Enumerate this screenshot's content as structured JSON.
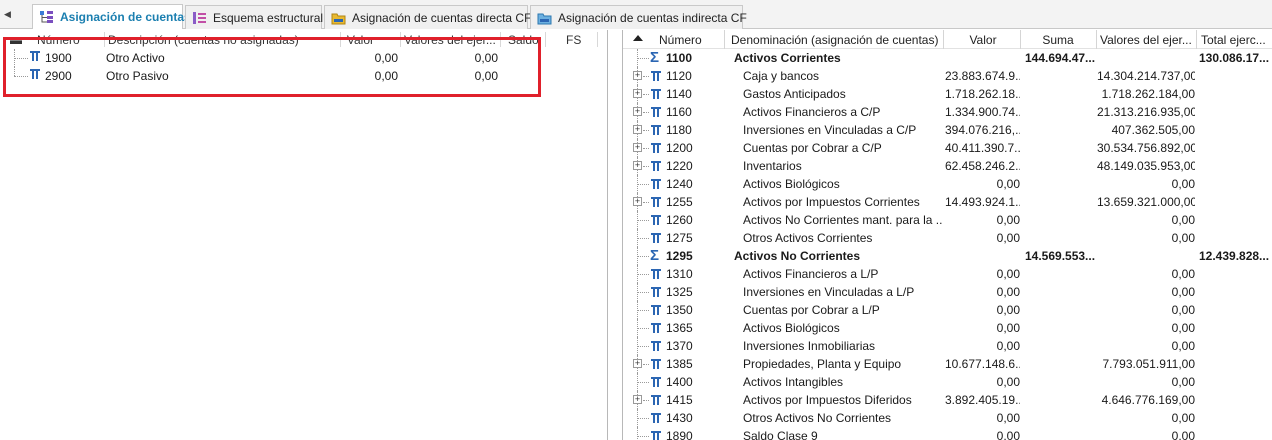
{
  "tabs": [
    {
      "label": "Asignación de cuentas",
      "icon": "hierarchy-icon",
      "active": true
    },
    {
      "label": "Esquema estructural",
      "icon": "structure-icon",
      "active": false
    },
    {
      "label": "Asignación de cuentas directa CF",
      "icon": "folder-icon",
      "active": false
    },
    {
      "label": "Asignación de cuentas indirecta CF",
      "icon": "folder-icon",
      "active": false
    }
  ],
  "left": {
    "headers": {
      "numero": "Número",
      "descripcion": "Descripción (cuentas no asignadas)",
      "valor": "Valor",
      "valores_ejer": "Valores del ejer...",
      "saldo": "Saldo",
      "fs": "FS"
    },
    "rows": [
      {
        "numero": "1900",
        "descripcion": "Otro Activo",
        "valor": "0,00",
        "valores_ejer": "0,00"
      },
      {
        "numero": "2900",
        "descripcion": "Otro Pasivo",
        "valor": "0,00",
        "valores_ejer": "0,00"
      }
    ]
  },
  "right": {
    "headers": {
      "numero": "Número",
      "denominacion": "Denominación (asignación de cuentas)",
      "valor": "Valor",
      "suma": "Suma",
      "valores_ejer": "Valores del ejer...",
      "total_ejerc": "Total ejerc..."
    },
    "rows": [
      {
        "numero": "1100",
        "denominacion": "Activos Corrientes",
        "valor": "",
        "suma": "144.694.47...",
        "valores_ejer": "",
        "total_ejerc": "130.086.17...",
        "type": "sum",
        "expander": false
      },
      {
        "numero": "1120",
        "denominacion": "Caja y bancos",
        "valor": "23.883.674.9...",
        "suma": "",
        "valores_ejer": "14.304.214.737,00",
        "total_ejerc": "",
        "type": "acc",
        "expander": true
      },
      {
        "numero": "1140",
        "denominacion": "Gastos Anticipados",
        "valor": "1.718.262.18...",
        "suma": "",
        "valores_ejer": "1.718.262.184,00",
        "total_ejerc": "",
        "type": "acc",
        "expander": true
      },
      {
        "numero": "1160",
        "denominacion": "Activos Financieros a C/P",
        "valor": "1.334.900.74...",
        "suma": "",
        "valores_ejer": "21.313.216.935,00",
        "total_ejerc": "",
        "type": "acc",
        "expander": true
      },
      {
        "numero": "1180",
        "denominacion": "Inversiones en Vinculadas a C/P",
        "valor": "394.076.216,...",
        "suma": "",
        "valores_ejer": "407.362.505,00",
        "total_ejerc": "",
        "type": "acc",
        "expander": true
      },
      {
        "numero": "1200",
        "denominacion": "Cuentas por Cobrar a C/P",
        "valor": "40.411.390.7...",
        "suma": "",
        "valores_ejer": "30.534.756.892,00",
        "total_ejerc": "",
        "type": "acc",
        "expander": true
      },
      {
        "numero": "1220",
        "denominacion": "Inventarios",
        "valor": "62.458.246.2...",
        "suma": "",
        "valores_ejer": "48.149.035.953,00",
        "total_ejerc": "",
        "type": "acc",
        "expander": true
      },
      {
        "numero": "1240",
        "denominacion": "Activos Biológicos",
        "valor": "0,00",
        "suma": "",
        "valores_ejer": "0,00",
        "total_ejerc": "",
        "type": "acc",
        "expander": false
      },
      {
        "numero": "1255",
        "denominacion": "Activos por Impuestos Corrientes",
        "valor": "14.493.924.1...",
        "suma": "",
        "valores_ejer": "13.659.321.000,00",
        "total_ejerc": "",
        "type": "acc",
        "expander": true
      },
      {
        "numero": "1260",
        "denominacion": "Activos No Corrientes mant. para la ...",
        "valor": "0,00",
        "suma": "",
        "valores_ejer": "0,00",
        "total_ejerc": "",
        "type": "acc",
        "expander": false
      },
      {
        "numero": "1275",
        "denominacion": "Otros Activos Corrientes",
        "valor": "0,00",
        "suma": "",
        "valores_ejer": "0,00",
        "total_ejerc": "",
        "type": "acc",
        "expander": false
      },
      {
        "numero": "1295",
        "denominacion": "Activos No Corrientes",
        "valor": "",
        "suma": "14.569.553...",
        "valores_ejer": "",
        "total_ejerc": "12.439.828...",
        "type": "sum",
        "expander": false
      },
      {
        "numero": "1310",
        "denominacion": "Activos Financieros a L/P",
        "valor": "0,00",
        "suma": "",
        "valores_ejer": "0,00",
        "total_ejerc": "",
        "type": "acc",
        "expander": false
      },
      {
        "numero": "1325",
        "denominacion": "Inversiones en Vinculadas a L/P",
        "valor": "0,00",
        "suma": "",
        "valores_ejer": "0,00",
        "total_ejerc": "",
        "type": "acc",
        "expander": false
      },
      {
        "numero": "1350",
        "denominacion": "Cuentas por Cobrar a L/P",
        "valor": "0,00",
        "suma": "",
        "valores_ejer": "0,00",
        "total_ejerc": "",
        "type": "acc",
        "expander": false
      },
      {
        "numero": "1365",
        "denominacion": "Activos Biológicos",
        "valor": "0,00",
        "suma": "",
        "valores_ejer": "0,00",
        "total_ejerc": "",
        "type": "acc",
        "expander": false
      },
      {
        "numero": "1370",
        "denominacion": "Inversiones Inmobiliarias",
        "valor": "0,00",
        "suma": "",
        "valores_ejer": "0,00",
        "total_ejerc": "",
        "type": "acc",
        "expander": false
      },
      {
        "numero": "1385",
        "denominacion": "Propiedades, Planta y Equipo",
        "valor": "10.677.148.6...",
        "suma": "",
        "valores_ejer": "7.793.051.911,00",
        "total_ejerc": "",
        "type": "acc",
        "expander": true
      },
      {
        "numero": "1400",
        "denominacion": "Activos Intangibles",
        "valor": "0,00",
        "suma": "",
        "valores_ejer": "0,00",
        "total_ejerc": "",
        "type": "acc",
        "expander": false
      },
      {
        "numero": "1415",
        "denominacion": "Activos por Impuestos Diferidos",
        "valor": "3.892.405.19...",
        "suma": "",
        "valores_ejer": "4.646.776.169,00",
        "total_ejerc": "",
        "type": "acc",
        "expander": true
      },
      {
        "numero": "1430",
        "denominacion": "Otros Activos No Corrientes",
        "valor": "0,00",
        "suma": "",
        "valores_ejer": "0,00",
        "total_ejerc": "",
        "type": "acc",
        "expander": false
      },
      {
        "numero": "1890",
        "denominacion": "Saldo Clase 9",
        "valor": "0,00",
        "suma": "",
        "valores_ejer": "0,00",
        "total_ejerc": "",
        "type": "acc",
        "expander": false
      }
    ]
  }
}
